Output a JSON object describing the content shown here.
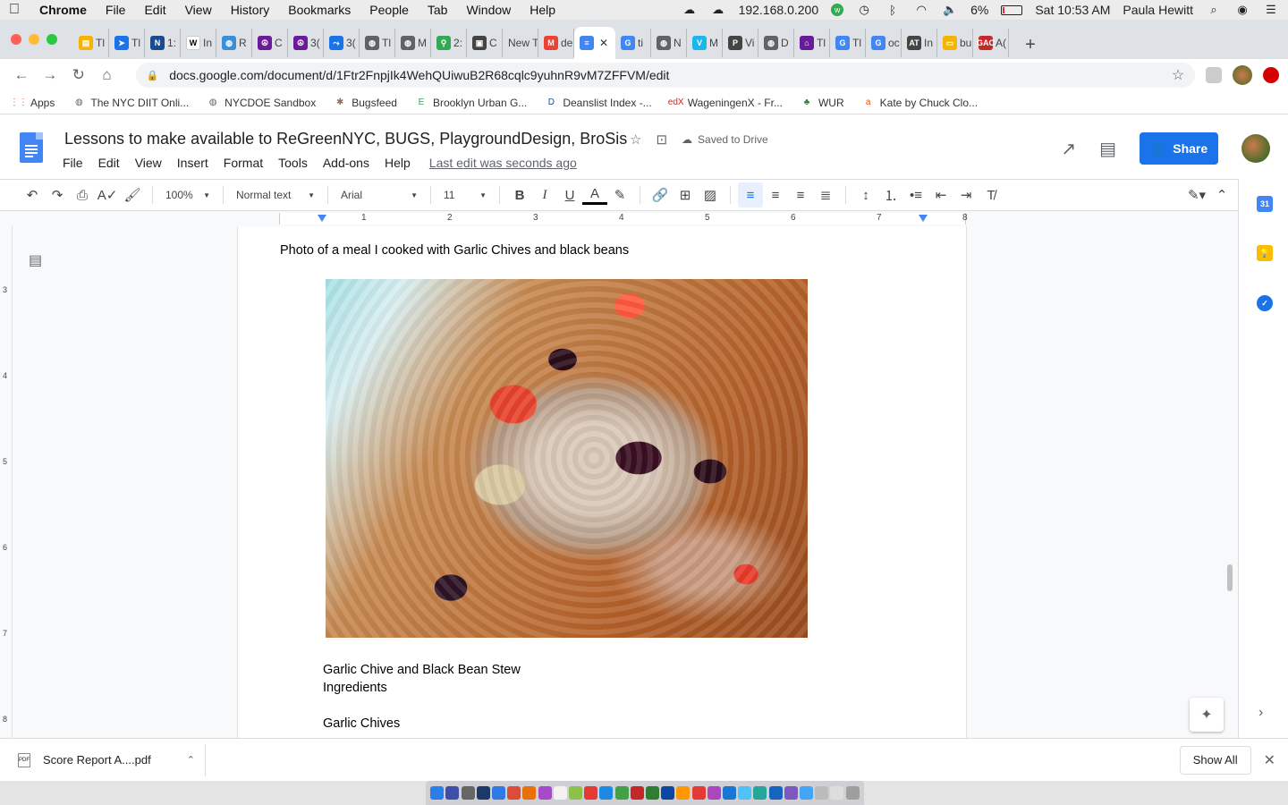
{
  "menubar": {
    "app_name": "Chrome",
    "items": [
      "File",
      "Edit",
      "View",
      "History",
      "Bookmarks",
      "People",
      "Tab",
      "Window",
      "Help"
    ],
    "ip": "192.168.0.200",
    "battery_text": "6%",
    "battery_level": 6,
    "clock": "Sat 10:53 AM",
    "user_name": "Paula Hewitt"
  },
  "tabs": [
    {
      "label": "Tl",
      "color": "#f4b400",
      "glyph": "▤"
    },
    {
      "label": "Tl",
      "color": "#1a73e8",
      "glyph": "➤"
    },
    {
      "label": "1:",
      "color": "#1a4b8c",
      "glyph": "N"
    },
    {
      "label": "In",
      "color": "#ffffff",
      "glyph": "W"
    },
    {
      "label": "R",
      "color": "#3b8fd6",
      "glyph": "◍"
    },
    {
      "label": "C",
      "color": "#6a1b9a",
      "glyph": "☮"
    },
    {
      "label": "3(",
      "color": "#6a1b9a",
      "glyph": "☮"
    },
    {
      "label": "3(",
      "color": "#1a73e8",
      "glyph": "⤳"
    },
    {
      "label": "Tl",
      "color": "#5f6368",
      "glyph": "◍"
    },
    {
      "label": "M",
      "color": "#5f6368",
      "glyph": "◍"
    },
    {
      "label": "2:",
      "color": "#34a853",
      "glyph": "⚲"
    },
    {
      "label": "C",
      "color": "#444444",
      "glyph": "▣"
    },
    {
      "label": "New T",
      "color": "",
      "glyph": ""
    },
    {
      "label": "de",
      "color": "#ea4335",
      "glyph": "M"
    },
    {
      "label": "",
      "color": "#4285f4",
      "glyph": "≡",
      "active": true
    },
    {
      "label": "ti",
      "color": "#4285f4",
      "glyph": "G"
    },
    {
      "label": "N",
      "color": "#5f6368",
      "glyph": "◍"
    },
    {
      "label": "M",
      "color": "#1ab7ea",
      "glyph": "V"
    },
    {
      "label": "Vi",
      "color": "#444444",
      "glyph": "P"
    },
    {
      "label": "D",
      "color": "#5f6368",
      "glyph": "◍"
    },
    {
      "label": "Tl",
      "color": "#6a1b9a",
      "glyph": "⌂"
    },
    {
      "label": "Tl",
      "color": "#4285f4",
      "glyph": "G"
    },
    {
      "label": "oc",
      "color": "#4285f4",
      "glyph": "G"
    },
    {
      "label": "In",
      "color": "#444444",
      "glyph": "AT"
    },
    {
      "label": "bu",
      "color": "#f4b400",
      "glyph": "▭"
    },
    {
      "label": "A(",
      "color": "#c62828",
      "glyph": "GAC"
    }
  ],
  "address": {
    "url": "docs.google.com/document/d/1Ftr2FnpjIk4WehQUiwuB2R68cqlc9yuhnR9vM7ZFFVM/edit"
  },
  "bookmarks": [
    {
      "label": "Apps",
      "color": "#ea4335",
      "glyph": "⋮⋮"
    },
    {
      "label": "The NYC DIIT Onli...",
      "color": "#5f6368",
      "glyph": "◍"
    },
    {
      "label": "NYCDOE Sandbox",
      "color": "#5f6368",
      "glyph": "◍"
    },
    {
      "label": "Bugsfeed",
      "color": "#8d6e63",
      "glyph": "✱"
    },
    {
      "label": "Brooklyn Urban G...",
      "color": "#34a853",
      "glyph": "E"
    },
    {
      "label": "Deanslist Index -...",
      "color": "#1a4b8c",
      "glyph": "D"
    },
    {
      "label": "WageningenX - Fr...",
      "color": "#c62828",
      "glyph": "edX"
    },
    {
      "label": "WUR",
      "color": "#2e7d32",
      "glyph": "♣"
    },
    {
      "label": "Kate by Chuck Clo...",
      "color": "#e65100",
      "glyph": "a"
    }
  ],
  "docs": {
    "title": "Lessons to make available to ReGreenNYC, BUGS, PlaygroundDesign, BroSis",
    "saved_status": "Saved to Drive",
    "menu": [
      "File",
      "Edit",
      "View",
      "Insert",
      "Format",
      "Tools",
      "Add-ons",
      "Help"
    ],
    "last_edit": "Last edit was seconds ago",
    "share_label": "Share"
  },
  "toolbar": {
    "zoom": "100%",
    "style": "Normal text",
    "font": "Arial",
    "size": "11"
  },
  "ruler": {
    "h_numbers": [
      "1",
      "2",
      "3",
      "4",
      "5",
      "6",
      "7",
      "8"
    ],
    "v_numbers": [
      "3",
      "4",
      "5",
      "6",
      "7",
      "8"
    ]
  },
  "document": {
    "caption": "Photo of a meal I cooked with Garlic Chives and black beans",
    "recipe_title": "Garlic Chive and Black Bean Stew",
    "ingredients_heading": "Ingredients",
    "ingredient_1": "Garlic Chives"
  },
  "downloads": {
    "file": "Score Report A....pdf",
    "show_all": "Show All"
  },
  "colors": {
    "accent": "#1a73e8",
    "docs_blue": "#4285f4"
  }
}
